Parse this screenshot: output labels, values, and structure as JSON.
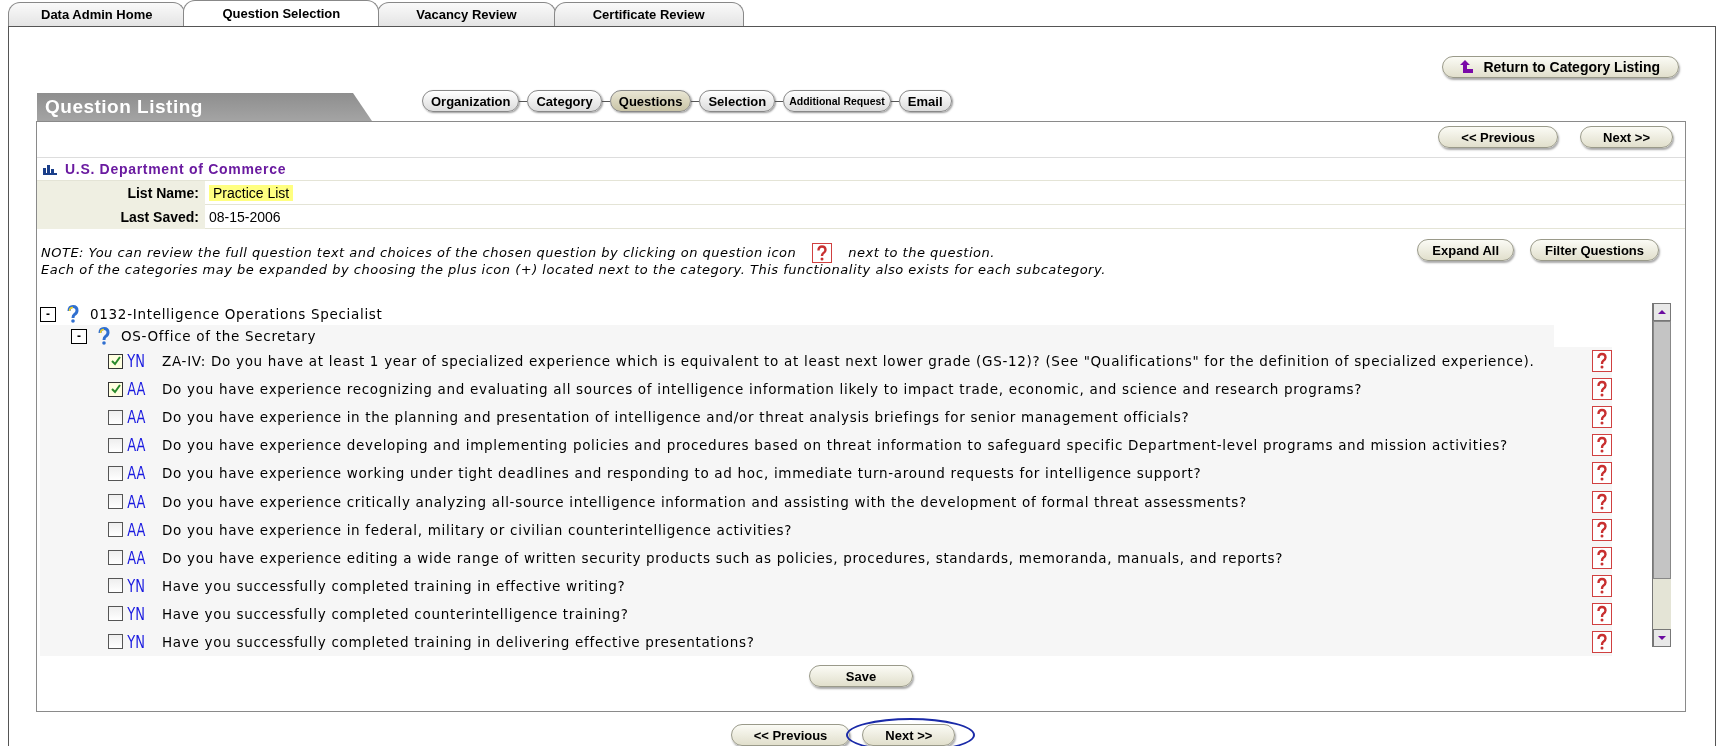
{
  "top_tabs": [
    {
      "label": "Data Admin Home",
      "selected": false
    },
    {
      "label": "Question Selection",
      "selected": true
    },
    {
      "label": "Vacancy Review",
      "selected": false
    },
    {
      "label": "Certificate Review",
      "selected": false
    }
  ],
  "return_button": "Return to Category Listing",
  "section_title": "Question Listing",
  "steps": [
    {
      "label": "Organization",
      "selected": false
    },
    {
      "label": "Category",
      "selected": false
    },
    {
      "label": "Questions",
      "selected": true
    },
    {
      "label": "Selection",
      "selected": false
    },
    {
      "label": "Additional Request",
      "selected": false
    },
    {
      "label": "Email",
      "selected": false
    }
  ],
  "nav_top": {
    "previous": "<< Previous",
    "next": "Next >>"
  },
  "organization": "U.S. Department of Commerce",
  "list_name": {
    "label": "List Name:",
    "value": "Practice List"
  },
  "last_saved": {
    "label": "Last Saved:",
    "value": "08-15-2006"
  },
  "note": {
    "line1": "NOTE: You can review the full question text and choices of the chosen question by clicking on question icon",
    "line1_end": "next to the question.",
    "line2": "Each of the categories may be expanded by choosing the plus icon (+) located next to the category. This functionality also exists for each subcategory."
  },
  "buttons": [
    "Expand All",
    "Filter Questions"
  ],
  "tree": [
    {
      "toggle": "-",
      "label": "0132-Intelligence Operations Specialist",
      "children": [
        {
          "toggle": "-",
          "label": "OS-Office of the Secretary",
          "questions": [
            {
              "type": "YN",
              "checked": true,
              "text": "ZA-IV: Do you have at least 1 year of specialized experience which is equivalent to at least next lower grade (GS-12)? (See \"Qualifications\" for the definition of specialized experience)."
            },
            {
              "type": "AA",
              "checked": true,
              "text": "Do you have experience recognizing and evaluating all sources of intelligence information likely to impact trade, economic, and science and research programs?"
            },
            {
              "type": "AA",
              "checked": false,
              "text": "Do you have experience in the planning and presentation of intelligence and/or threat analysis briefings for senior management officials?"
            },
            {
              "type": "AA",
              "checked": false,
              "text": "Do you have experience developing and implementing policies and procedures based on threat information to safeguard specific Department-level programs and mission activities?"
            },
            {
              "type": "AA",
              "checked": false,
              "text": "Do you have experience working under tight deadlines and responding to ad hoc, immediate turn-around requests for intelligence support?"
            },
            {
              "type": "AA",
              "checked": false,
              "text": "Do you have experience critically analyzing all-source intelligence information and assisting with the development of formal threat assessments?"
            },
            {
              "type": "AA",
              "checked": false,
              "text": "Do you have experience in federal, military or civilian counterintelligence activities?"
            },
            {
              "type": "AA",
              "checked": false,
              "text": "Do you have experience editing a wide range of written security products such as policies, procedures, standards, memoranda, manuals, and reports?"
            },
            {
              "type": "YN",
              "checked": false,
              "text": "Have you successfully completed training in effective writing?"
            },
            {
              "type": "YN",
              "checked": false,
              "text": "Have you successfully completed counterintelligence training?"
            },
            {
              "type": "YN",
              "checked": false,
              "text": "Have you successfully completed training in delivering effective presentations?"
            }
          ]
        }
      ]
    }
  ],
  "save": "Save",
  "nav_bottom": {
    "previous": "<< Previous",
    "next": "Next >>",
    "next_highlighted": true
  }
}
